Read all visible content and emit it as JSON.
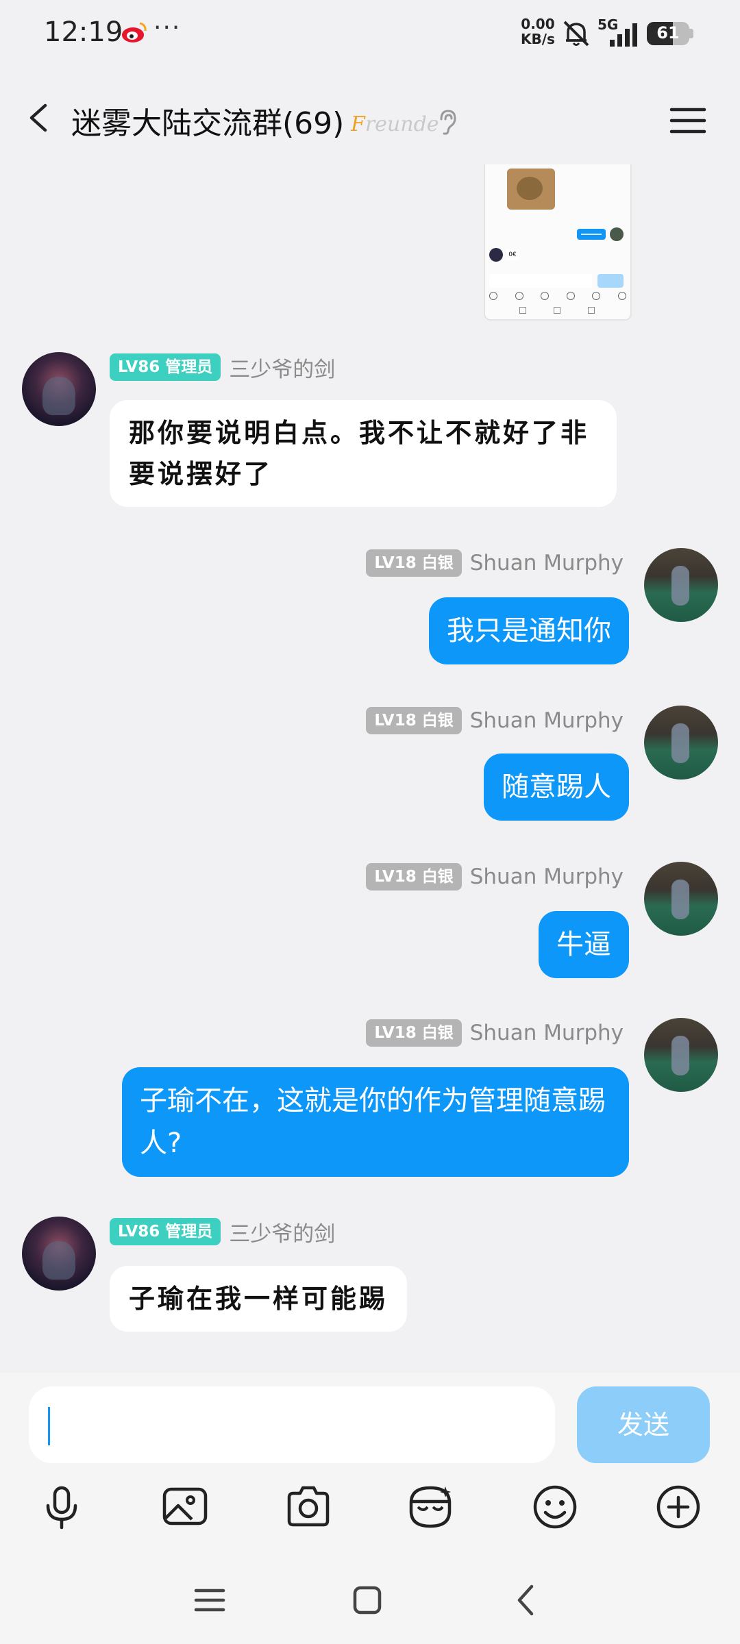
{
  "status_bar": {
    "time": "12:19",
    "dots": "···",
    "net_speed_value": "0.00",
    "net_speed_unit": "KB/s",
    "network": "5G",
    "battery": "61",
    "battery_level": 0.61
  },
  "header": {
    "title": "迷雾大陆交流群(69)",
    "brand_initial": "F",
    "brand_rest": "reunde"
  },
  "messages": [
    {
      "side": "left",
      "level_badge": "LV86 管理员",
      "sender": "三少爷的剑",
      "text": "那你要说明白点。我不让不就好了非要说摆好了"
    },
    {
      "side": "right",
      "level_badge": "LV18 白银",
      "sender": "Shuan Murphy",
      "text": "我只是通知你"
    },
    {
      "side": "right",
      "level_badge": "LV18 白银",
      "sender": "Shuan Murphy",
      "text": "随意踢人"
    },
    {
      "side": "right",
      "level_badge": "LV18 白银",
      "sender": "Shuan Murphy",
      "text": "牛逼"
    },
    {
      "side": "right",
      "level_badge": "LV18 白银",
      "sender": "Shuan Murphy",
      "text": "子瑜不在，这就是你的作为管理随意踢人?"
    },
    {
      "side": "left",
      "level_badge": "LV86 管理员",
      "sender": "三少爷的剑",
      "text": "子瑜在我一样可能踢"
    }
  ],
  "quoted_image": {
    "tiny_label": "0€"
  },
  "input": {
    "value": "",
    "send_label": "发送"
  },
  "toolbar": [
    "microphone-icon",
    "image-icon",
    "camera-icon",
    "sticker-icon",
    "emoji-icon",
    "plus-icon"
  ],
  "colors": {
    "accent": "#0d97f9",
    "admin_badge": "#3dcfbf",
    "silver_badge": "#b4b4b4",
    "send_disabled": "#8dcdf9"
  }
}
